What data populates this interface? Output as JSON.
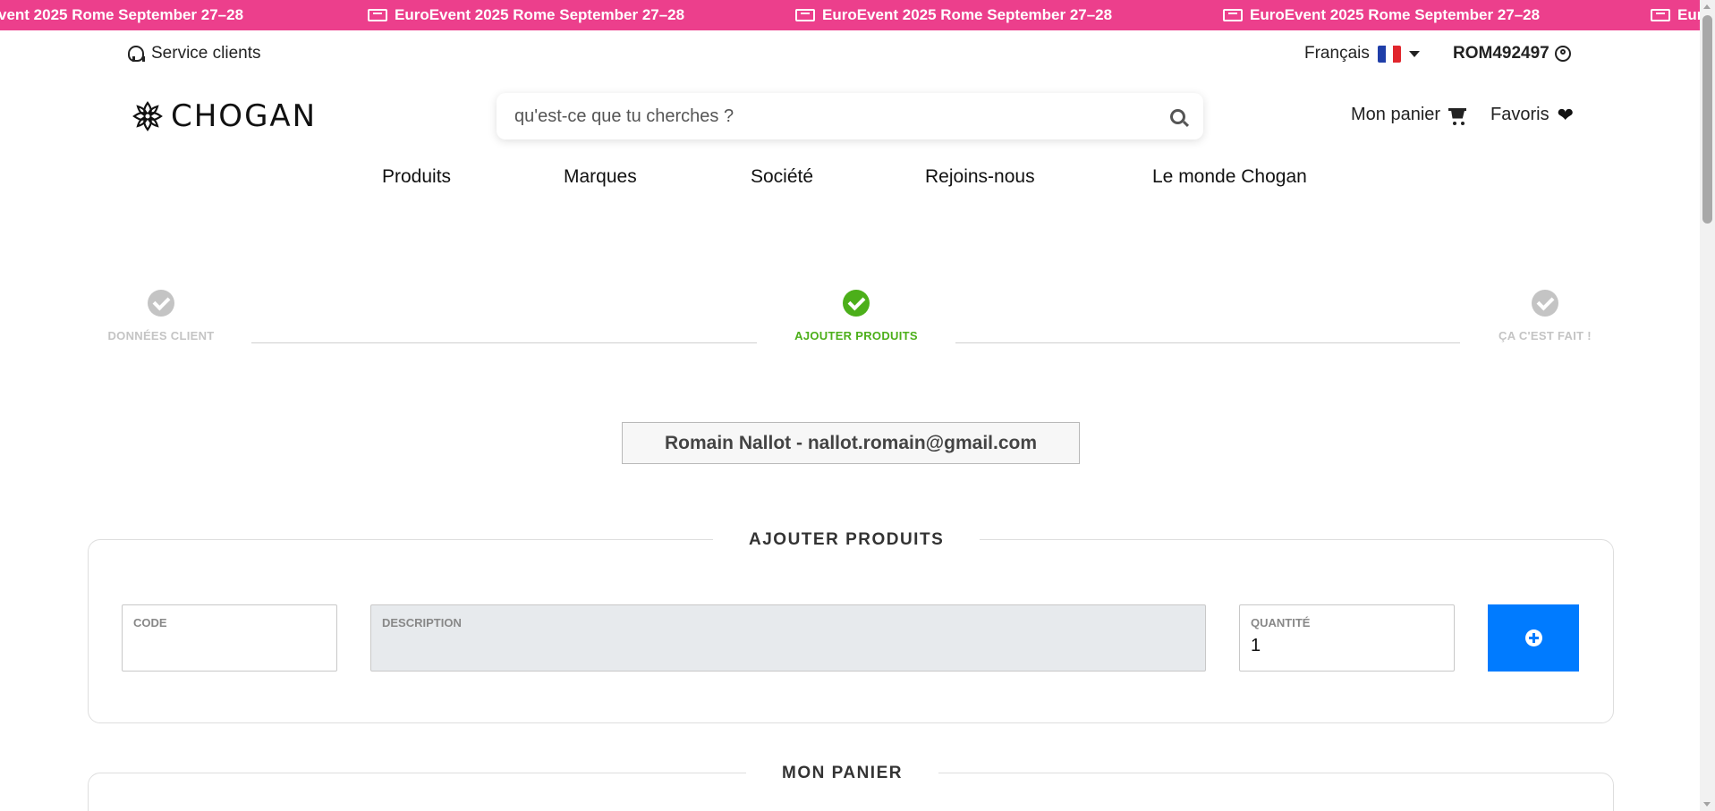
{
  "promo": {
    "text": "EuroEvent 2025 Rome September 27–28",
    "text_cut": "vent 2025 Rome September 27–28",
    "text_tail": "Euro"
  },
  "topbar": {
    "service": "Service clients",
    "language": "Français",
    "account": "ROM492497"
  },
  "header": {
    "logo": "CHOGAN",
    "search_placeholder": "qu'est-ce que tu cherches ?",
    "cart": "Mon panier",
    "favorites": "Favoris"
  },
  "nav": {
    "items": [
      "Produits",
      "Marques",
      "Société",
      "Rejoins-nous",
      "Le monde Chogan"
    ]
  },
  "steps": [
    {
      "label": "DONNÉES CLIENT",
      "state": "done"
    },
    {
      "label": "AJOUTER PRODUITS",
      "state": "active"
    },
    {
      "label": "ÇA C'EST FAIT !",
      "state": "pending"
    }
  ],
  "client": {
    "info": "Romain Nallot - nallot.romain@gmail.com"
  },
  "add_products": {
    "title": "AJOUTER PRODUITS",
    "code_label": "CODE",
    "code_value": "",
    "description_label": "DESCRIPTION",
    "quantity_label": "QUANTITÉ",
    "quantity_value": "1"
  },
  "cart_panel": {
    "title": "MON PANIER"
  },
  "colors": {
    "promo": "#ec3f8c",
    "active_step": "#4caf1a",
    "inactive_step": "#c4c4c4",
    "add_button": "#007bff"
  }
}
